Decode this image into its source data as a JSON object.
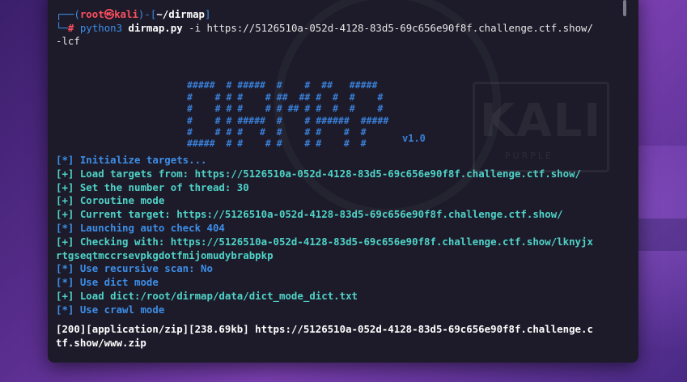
{
  "prompt": {
    "user": "root",
    "skull": "㉿",
    "host": "kali",
    "path": "~/dirmap",
    "sigil": "#"
  },
  "command": {
    "program": "python3",
    "script": "dirmap.py",
    "args_line1": "-i https://5126510a-052d-4128-83d5-69c656e90f8f.challenge.ctf.show/",
    "args_line2": "-lcf"
  },
  "banner": {
    "art": [
      "#####  # #####  #    #  ##   #####",
      "#    # # #    # ##  ## #  #  #    #",
      "#    # # #    # # ## # #  #  #    #",
      "#    # # #####  #    # ######  #####",
      "#    # # #   #  #    # #    #  #",
      "#####  # #    # #    # #    #  #"
    ],
    "version": "v1.0"
  },
  "log": [
    {
      "tag": "[*]",
      "text": "Initialize targets...",
      "color": "blue"
    },
    {
      "tag": "[+]",
      "text": "Load targets from: https://5126510a-052d-4128-83d5-69c656e90f8f.challenge.ctf.show/",
      "color": "green"
    },
    {
      "tag": "[+]",
      "text": "Set the number of thread: 30",
      "color": "green"
    },
    {
      "tag": "[+]",
      "text": "Coroutine mode",
      "color": "green"
    },
    {
      "tag": "[+]",
      "text": "Current target: https://5126510a-052d-4128-83d5-69c656e90f8f.challenge.ctf.show/",
      "color": "green"
    },
    {
      "tag": "[*]",
      "text": "Launching auto check 404",
      "color": "blue"
    },
    {
      "tag": "[+]",
      "text": "Checking with: https://5126510a-052d-4128-83d5-69c656e90f8f.challenge.ctf.show/lknyjx",
      "color": "green"
    },
    {
      "tag": "",
      "text": "rtgseqtmccrsevpkgdotfmijomudybrabpkp",
      "color": "green"
    },
    {
      "tag": "[*]",
      "text": "Use recursive scan: No",
      "color": "blue"
    },
    {
      "tag": "[*]",
      "text": "Use dict mode",
      "color": "blue"
    },
    {
      "tag": "[+]",
      "text": "Load dict:/root/dirmap/data/dict_mode_dict.txt",
      "color": "green"
    },
    {
      "tag": "[*]",
      "text": "Use crawl mode",
      "color": "blue"
    }
  ],
  "result": {
    "line1": "[200][application/zip][238.69kb] https://5126510a-052d-4128-83d5-69c656e90f8f.challenge.c",
    "line2": "tf.show/www.zip"
  },
  "watermark": {
    "brand": "KALI",
    "sub": "PURPLE"
  },
  "colors": {
    "blue": "#3d8ee8",
    "green": "#4fd3c8",
    "red": "#ff4f5e",
    "background": "#1d1b29"
  }
}
